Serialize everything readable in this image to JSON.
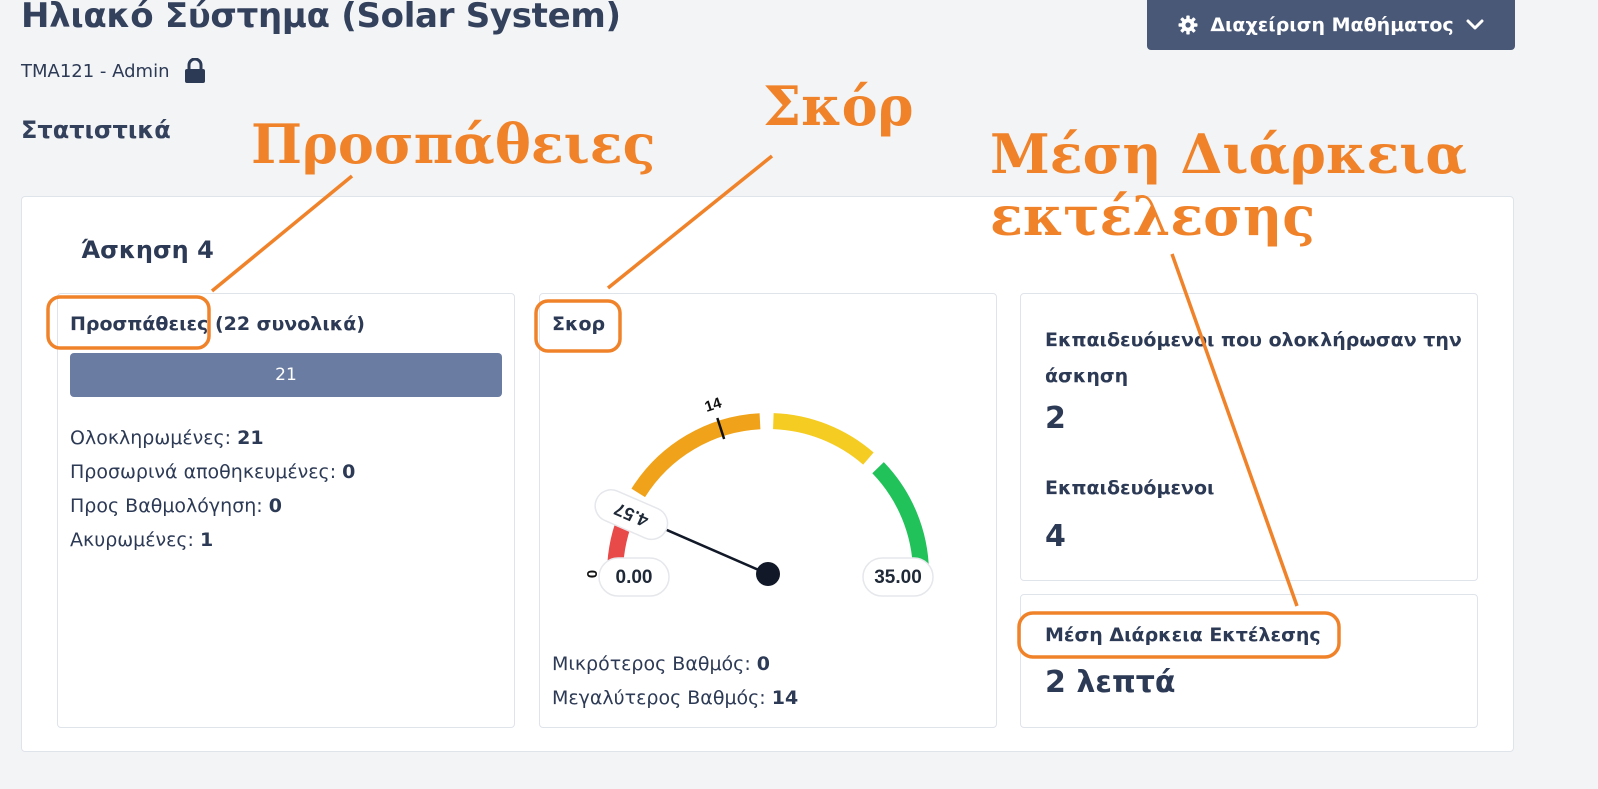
{
  "header": {
    "title": "Ηλιακό Σύστημα (Solar System)",
    "course_code": "TMA121 - Admin",
    "manage_button": "Διαχείριση Μαθήματος",
    "icons": {
      "lock": "lock-icon",
      "gear": "gear-icon",
      "chevron": "chevron-down-icon"
    }
  },
  "section_title": "Στατιστικά",
  "exercise_title": "Άσκηση 4",
  "attempts": {
    "title": "Προσπάθειες",
    "total_text": "(22 συνολικά)",
    "bar_label": "21",
    "bar_fraction": 1.0,
    "completed_label": "Ολοκληρωμένες:",
    "completed_value": "21",
    "temp_saved_label": "Προσωρινά αποθηκευμένες:",
    "temp_saved_value": "0",
    "to_grade_label": "Προς Βαθμολόγηση:",
    "to_grade_value": "0",
    "cancelled_label": "Ακυρωμένες:",
    "cancelled_value": "1"
  },
  "score": {
    "title": "Σκορ",
    "gauge_min": 0,
    "gauge_max": 35,
    "gauge_value": 4.57,
    "gauge_value_label": "4.57",
    "max_grade_mark": 14,
    "max_grade_mark_label": "14",
    "zero_tick_label": "0",
    "min_label": "0.00",
    "max_label": "35.00",
    "colors": {
      "red": "#e84a4a",
      "orange": "#f0a31a",
      "yellow": "#f5cc22",
      "green": "#22c25a",
      "needle": "#111827"
    },
    "min_grade_label": "Μικρότερος Βαθμός:",
    "min_grade_value": "0",
    "max_grade_label": "Μεγαλύτερος Βαθμός:",
    "max_grade_value": "14"
  },
  "trainees": {
    "completed_label": "Εκπαιδευόμενοι που ολοκλήρωσαν την άσκηση",
    "completed_value": "2",
    "total_label": "Εκπαιδευόμενοι",
    "total_value": "4"
  },
  "duration": {
    "label": "Μέση Διάρκεια Εκτέλεσης",
    "value": "2 λεπτά"
  },
  "annotations": {
    "attempts": "Προσπάθειες",
    "score": "Σκόρ",
    "duration_line1": "Μέση Διάρκεια",
    "duration_line2": "εκτέλεσης",
    "color": "#f0832a"
  }
}
